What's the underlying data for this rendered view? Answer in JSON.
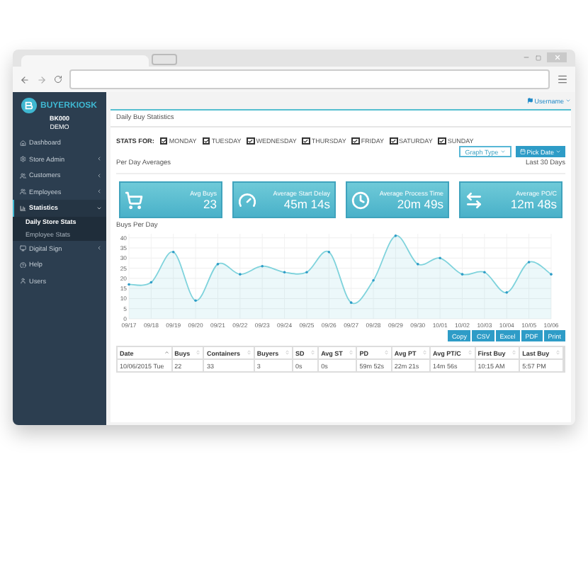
{
  "sidebar": {
    "logo": "BUYERKIOSK",
    "store_code": "BK000",
    "store_name": "DEMO",
    "items": [
      {
        "label": "Dashboard",
        "expandable": false,
        "selected": false
      },
      {
        "label": "Store Admin",
        "expandable": true,
        "expanded": false,
        "selected": false
      },
      {
        "label": "Customers",
        "expandable": true,
        "expanded": false,
        "selected": false
      },
      {
        "label": "Employees",
        "expandable": true,
        "expanded": false,
        "selected": false
      },
      {
        "label": "Statistics",
        "expandable": true,
        "expanded": true,
        "selected": true,
        "children": [
          {
            "label": "Daily Store Stats",
            "selected": true
          },
          {
            "label": "Employee Stats",
            "selected": false
          }
        ]
      },
      {
        "label": "Digital Sign",
        "expandable": true,
        "expanded": false,
        "selected": false
      },
      {
        "label": "Help",
        "expandable": false,
        "selected": false
      },
      {
        "label": "Users",
        "expandable": false,
        "selected": false
      }
    ]
  },
  "user_menu": "Username",
  "panel": {
    "title": "Daily Buy Statistics",
    "stats_for_label": "STATS FOR:",
    "days": [
      {
        "label": "MONDAY",
        "checked": true
      },
      {
        "label": "TUESDAY",
        "checked": true
      },
      {
        "label": "WEDNESDAY",
        "checked": true
      },
      {
        "label": "THURSDAY",
        "checked": true
      },
      {
        "label": "FRIDAY",
        "checked": true
      },
      {
        "label": "SATURDAY",
        "checked": true
      },
      {
        "label": "SUNDAY",
        "checked": true
      }
    ],
    "graph_type_button": "Graph Type",
    "pick_date_button": "Pick Date",
    "averages_label": "Per Day Averages",
    "range_label": "Last 30 Days",
    "stat_boxes": [
      {
        "kind": "cart",
        "label": "Avg Buys",
        "value": "23"
      },
      {
        "kind": "gauge",
        "label": "Average Start Delay",
        "value": "45m 14s"
      },
      {
        "kind": "clock",
        "label": "Average Process Time",
        "value": "20m 49s"
      },
      {
        "kind": "transfer",
        "label": "Average PO/C",
        "value": "12m 48s"
      }
    ],
    "chart_title": "Buys Per Day",
    "chart_data": {
      "type": "area",
      "grid": true,
      "categories": [
        "09/17",
        "09/18",
        "09/19",
        "09/20",
        "09/21",
        "09/22",
        "09/23",
        "09/24",
        "09/25",
        "09/26",
        "09/27",
        "09/28",
        "09/29",
        "09/30",
        "10/01",
        "10/02",
        "10/03",
        "10/04",
        "10/05",
        "10/06"
      ],
      "series": [
        {
          "color": "#7fd3dc",
          "values": [
            17,
            18,
            33,
            9,
            27,
            22,
            26,
            23,
            23,
            33,
            8,
            19,
            41,
            27,
            30,
            22,
            23,
            13,
            28,
            22
          ]
        }
      ],
      "ylim": [
        0,
        42
      ],
      "yticks": [
        0,
        5,
        10,
        15,
        20,
        25,
        30,
        35,
        40
      ]
    },
    "export_buttons": [
      "Copy",
      "CSV",
      "Excel",
      "PDF",
      "Print"
    ],
    "table": {
      "columns": [
        {
          "label": "Date",
          "sorted": true
        },
        {
          "label": "Buys",
          "sorted": false
        },
        {
          "label": "Containers",
          "sorted": false
        },
        {
          "label": "Buyers",
          "sorted": false
        },
        {
          "label": "SD",
          "sorted": false
        },
        {
          "label": "Avg ST",
          "sorted": false
        },
        {
          "label": "PD",
          "sorted": false
        },
        {
          "label": "Avg PT",
          "sorted": false
        },
        {
          "label": "Avg PT/C",
          "sorted": false
        },
        {
          "label": "First Buy",
          "sorted": false
        },
        {
          "label": "Last Buy",
          "sorted": false
        }
      ],
      "rows": [
        [
          "10/06/2015 Tue",
          "22",
          "33",
          "3",
          "0s",
          "0s",
          "59m 52s",
          "22m 21s",
          "14m 56s",
          "10:15 AM",
          "5:57 PM"
        ]
      ]
    }
  }
}
